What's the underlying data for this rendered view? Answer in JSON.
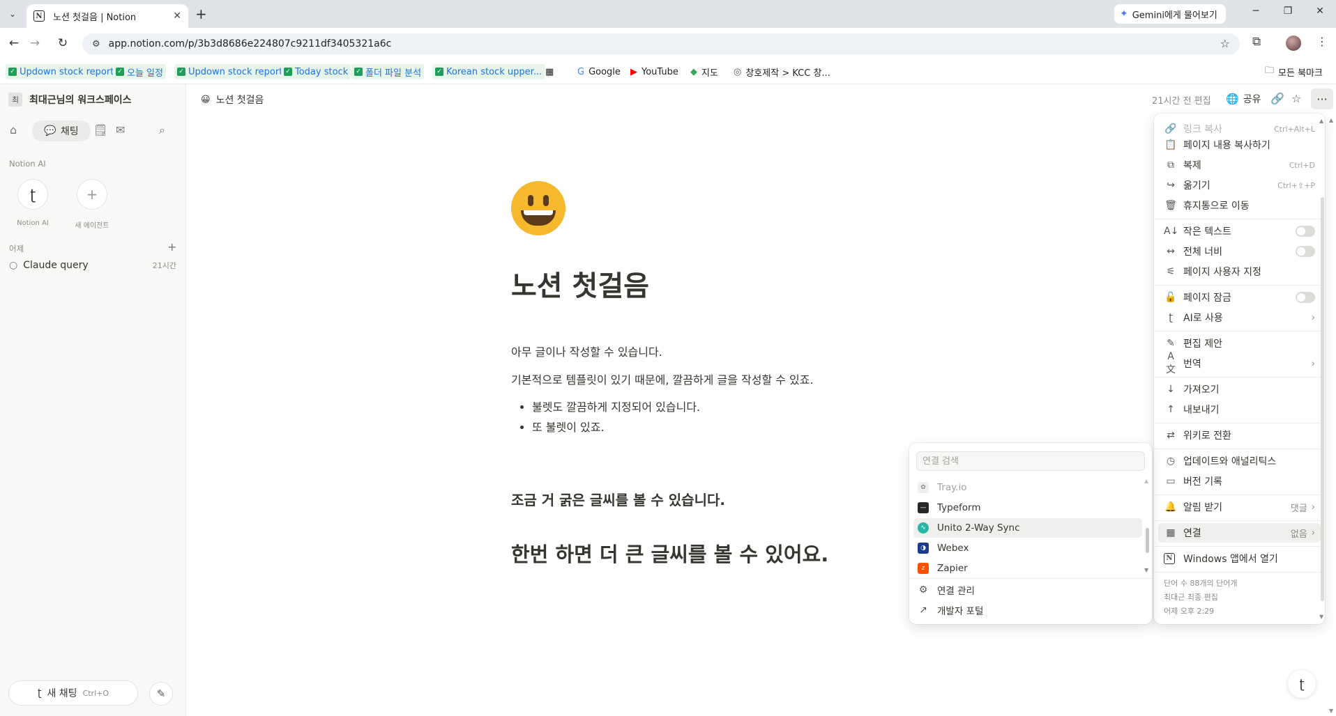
{
  "browser": {
    "tab_title": "노션 첫걸음 | Notion",
    "tab_favicon": "N",
    "gemini_label": "Gemini에게 물어보기",
    "url": "app.notion.com/p/3b3d8686e224807c9211df3405321a6c",
    "bookmarks": [
      {
        "label": "Updown stock report",
        "style": "green"
      },
      {
        "label": "오늘 일정",
        "style": "green"
      },
      {
        "label": "Updown stock report",
        "style": "green"
      },
      {
        "label": "Today stock",
        "style": "green"
      },
      {
        "label": "폴더 파일 분석",
        "style": "green"
      },
      {
        "label": "Korean stock upper...",
        "style": "green"
      },
      {
        "label": "Google",
        "style": "plain"
      },
      {
        "label": "YouTube",
        "style": "plain"
      },
      {
        "label": "지도",
        "style": "plain"
      },
      {
        "label": "창호제작 > KCC 창...",
        "style": "plain"
      }
    ],
    "all_bookmarks": "모든 북마크"
  },
  "sidebar": {
    "workspace_avatar": "최",
    "workspace_name": "최대근님의 워크스페이스",
    "chat_tab": "채팅",
    "section_ai": "Notion AI",
    "agents": [
      {
        "label": "Notion AI"
      },
      {
        "label": "새 에이전트"
      }
    ],
    "section_yesterday": "어제",
    "history": [
      {
        "title": "Claude query",
        "time": "21시간"
      }
    ],
    "new_chat": "새 채팅",
    "new_chat_shortcut": "Ctrl+O"
  },
  "header": {
    "page_emoji": "😀",
    "page_title": "노션 첫걸음",
    "edited": "21시간 전 편집",
    "share": "공유"
  },
  "page": {
    "title": "노션 첫걸음",
    "para1": "아무 글이나 작성할 수 있습니다.",
    "para2": "기본적으로 템플릿이 있기 때문에, 깔끔하게 글을 작성할 수 있죠.",
    "bullets": [
      "불렛도 깔끔하게 지정되어 있습니다.",
      "또 불렛이 있죠."
    ],
    "heading3": "조금 거 굵은 글씨를 볼 수 있습니다.",
    "heading2": "한번 하면 더 큰 글씨를 볼 수 있어요."
  },
  "menu": {
    "items": [
      {
        "label": "링크 복사",
        "shortcut": "Ctrl+Alt+L"
      },
      {
        "label": "페이지 내용 복사하기",
        "shortcut": ""
      },
      {
        "label": "복제",
        "shortcut": "Ctrl+D"
      },
      {
        "label": "옮기기",
        "shortcut": "Ctrl+⇧+P"
      },
      {
        "label": "휴지통으로 이동",
        "shortcut": ""
      },
      {
        "label": "작은 텍스트",
        "toggle": false
      },
      {
        "label": "전체 너비",
        "toggle": false
      },
      {
        "label": "페이지 사용자 지정"
      },
      {
        "label": "페이지 잠금",
        "toggle": false
      },
      {
        "label": "AI로 사용"
      },
      {
        "label": "편집 제안"
      },
      {
        "label": "번역"
      },
      {
        "label": "가져오기"
      },
      {
        "label": "내보내기"
      },
      {
        "label": "위키로 전환"
      },
      {
        "label": "업데이트와 애널리틱스"
      },
      {
        "label": "버전 기록"
      },
      {
        "label": "알림 받기",
        "value": "댓글"
      },
      {
        "label": "연결",
        "value": "없음"
      },
      {
        "label": "Windows 앱에서 열기"
      }
    ],
    "footer": [
      "단어 수 88개의 단어개",
      "최대근 최종 편집",
      "어제 오후 2:29"
    ]
  },
  "connections": {
    "search_placeholder": "연결 검색",
    "items": [
      {
        "label": "Tray.io",
        "color": "#9a9a9a"
      },
      {
        "label": "Typeform",
        "color": "#262627"
      },
      {
        "label": "Unito 2-Way Sync",
        "color": "#28b5a6"
      },
      {
        "label": "Webex",
        "color": "#1d3b8a"
      },
      {
        "label": "Zapier",
        "color": "#ff4f00"
      }
    ],
    "manage": "연결 관리",
    "dev_portal": "개발자 포털"
  }
}
